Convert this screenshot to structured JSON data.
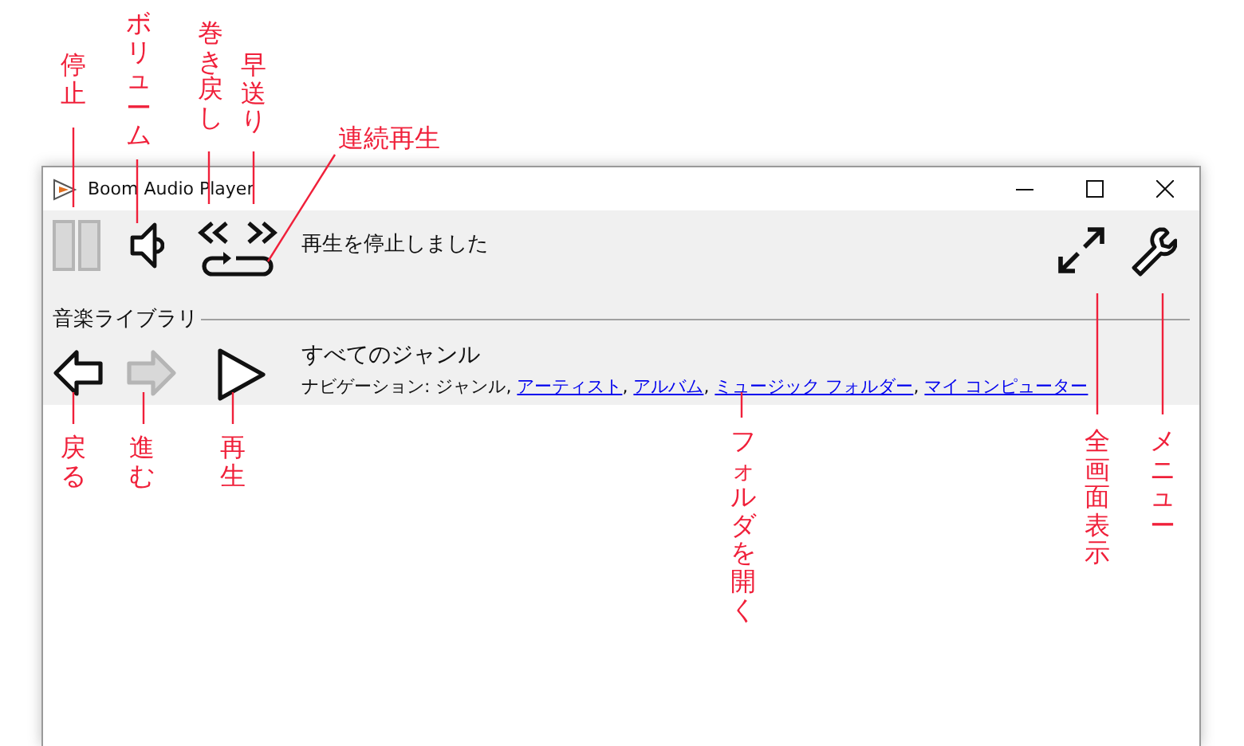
{
  "window": {
    "title": "Boom Audio Player"
  },
  "toolbar": {
    "buttons": [
      {
        "kind": "stop",
        "disabled": true
      },
      {
        "kind": "volume",
        "disabled": false
      },
      {
        "kind": "rewind",
        "disabled": false
      },
      {
        "kind": "forward",
        "disabled": false
      },
      {
        "kind": "repeat",
        "disabled": false
      }
    ],
    "status": "再生を停止しました",
    "right_buttons": [
      {
        "kind": "fullscreen"
      },
      {
        "kind": "menu"
      }
    ]
  },
  "library": {
    "heading": "音楽ライブラリ",
    "buttons": [
      {
        "kind": "back",
        "disabled": false
      },
      {
        "kind": "next",
        "disabled": true
      },
      {
        "kind": "play",
        "disabled": false
      }
    ],
    "genre": "すべてのジャンル",
    "navigation": [
      {
        "kind": "text",
        "label": "ナビゲーション: ジャンル, "
      },
      {
        "kind": "link",
        "label": "アーティスト"
      },
      {
        "kind": "text",
        "label": ", "
      },
      {
        "kind": "link",
        "label": "アルバム"
      },
      {
        "kind": "text",
        "label": ", "
      },
      {
        "kind": "link",
        "label": "ミュージック フォルダー"
      },
      {
        "kind": "text",
        "label": ", "
      },
      {
        "kind": "link",
        "label": "マイ コンピューター"
      }
    ]
  },
  "annotations": [
    {
      "text": "停止",
      "kind": "vertical"
    },
    {
      "text": "ボリューム",
      "kind": "vertical"
    },
    {
      "text": "巻き戻し",
      "kind": "vertical"
    },
    {
      "text": "早送り",
      "kind": "vertical"
    },
    {
      "text": "連続再生",
      "kind": "horizontal"
    },
    {
      "text": "戻る",
      "kind": "vertical"
    },
    {
      "text": "進む",
      "kind": "vertical"
    },
    {
      "text": "再生",
      "kind": "vertical"
    },
    {
      "text": "フォルダを開く",
      "kind": "vertical"
    },
    {
      "text": "全画面表示",
      "kind": "vertical"
    },
    {
      "text": "メニュー",
      "kind": "vertical"
    }
  ]
}
